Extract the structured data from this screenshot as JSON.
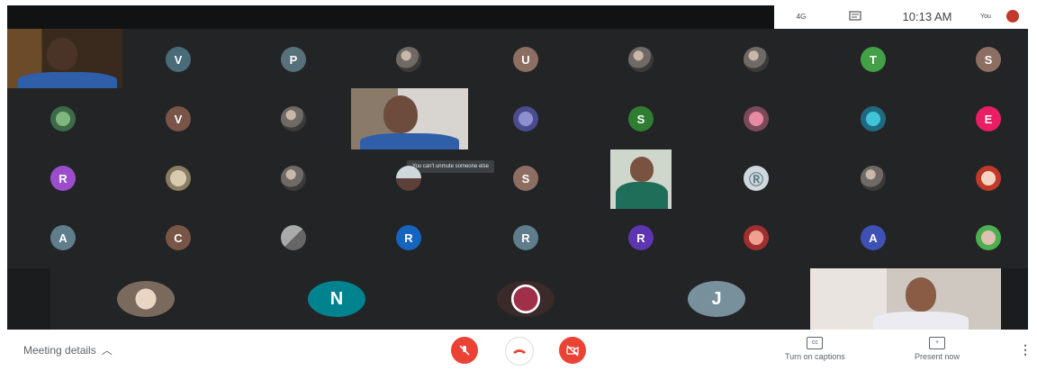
{
  "status": {
    "time": "10:13 AM",
    "you_label": "You",
    "signal_text": "4G"
  },
  "tooltip": "You can't unmute someone else",
  "row1": [
    "V",
    "P",
    "",
    "U",
    "",
    "",
    "T",
    "S"
  ],
  "row2": [
    "",
    "V",
    "",
    "",
    "S",
    "",
    "",
    "E"
  ],
  "row3": [
    "R",
    "",
    "",
    "",
    "S",
    "",
    "",
    ""
  ],
  "row4": [
    "A",
    "C",
    "",
    "R",
    "R",
    "R",
    "",
    "A",
    ""
  ],
  "row5": [
    "",
    "N",
    "",
    "J"
  ],
  "bottom": {
    "meeting_details": "Meeting details",
    "captions": "Turn on captions",
    "present": "Present now"
  },
  "colors": {
    "accent_red": "#ea4335",
    "grid_bg": "#232426",
    "V": "#4a6b78",
    "P": "#57707a",
    "U": "#8d6e63",
    "T": "#43a047",
    "S_1": "#8d6e63",
    "V2": "#795548",
    "S_2": "#2e7d32",
    "E": "#e91e63",
    "R_purple": "#9c4dcc",
    "S_3": "#8d6e63",
    "A": "#607d8b",
    "C": "#795548",
    "R_blue": "#1565c0",
    "R_gray": "#607d8b",
    "R_violet": "#5e35b1",
    "A2": "#3f51b5",
    "N": "#00838f",
    "J": "#78909c"
  }
}
